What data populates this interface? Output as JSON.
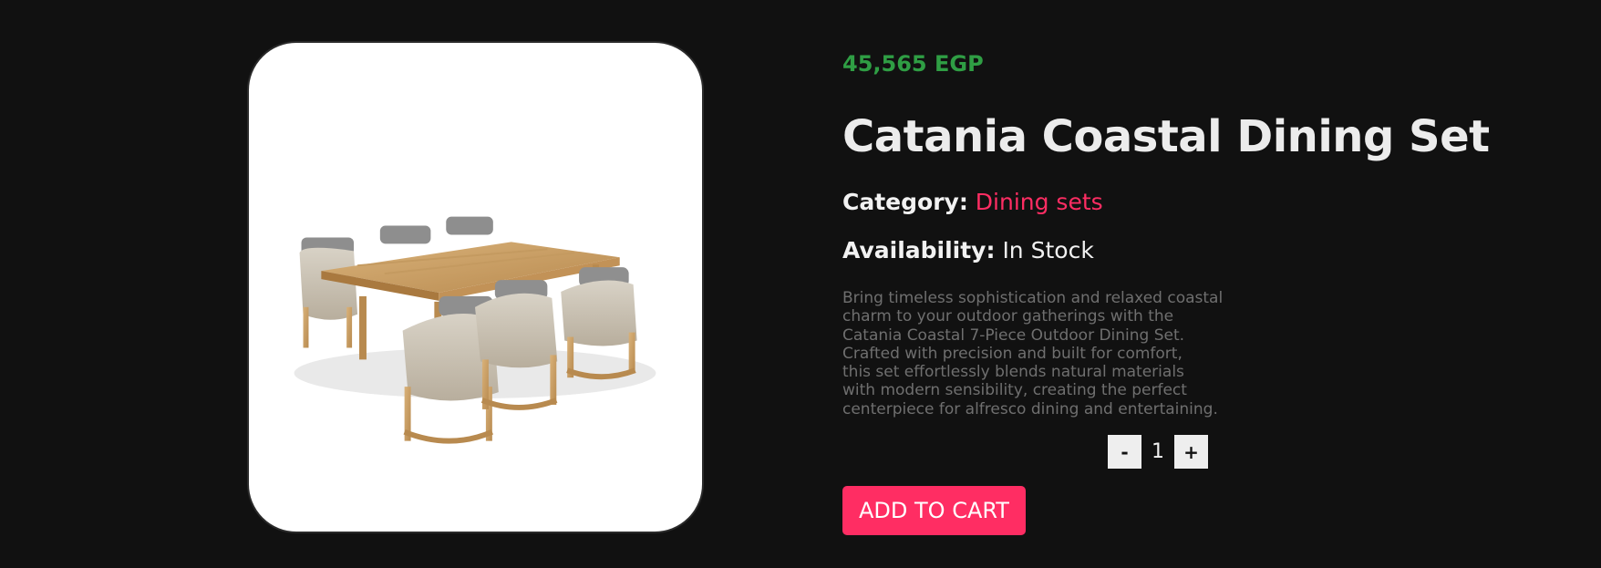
{
  "product": {
    "price": "45,565 EGP",
    "title": "Catania Coastal Dining Set",
    "category_label": "Category:",
    "category_value": "Dining sets",
    "availability_label": "Availability:",
    "availability_value": "In Stock",
    "description": "Bring timeless sophistication and relaxed coastal\ncharm to your outdoor gatherings with the\nCatania Coastal 7-Piece Outdoor Dining Set.\nCrafted with precision and built for comfort,\nthis set effortlessly blends natural materials\nwith modern sensibility, creating the perfect\ncenterpiece for alfresco dining and entertaining.",
    "image_icon": "dining-set-image"
  },
  "quantity": {
    "minus_label": "-",
    "value": "1",
    "plus_label": "+"
  },
  "cart": {
    "add_label": "ADD TO CART"
  },
  "colors": {
    "background": "#111111",
    "price": "#2f9e44",
    "accent": "#ff2d63",
    "title": "#ececec",
    "description": "#6f6f6f"
  }
}
